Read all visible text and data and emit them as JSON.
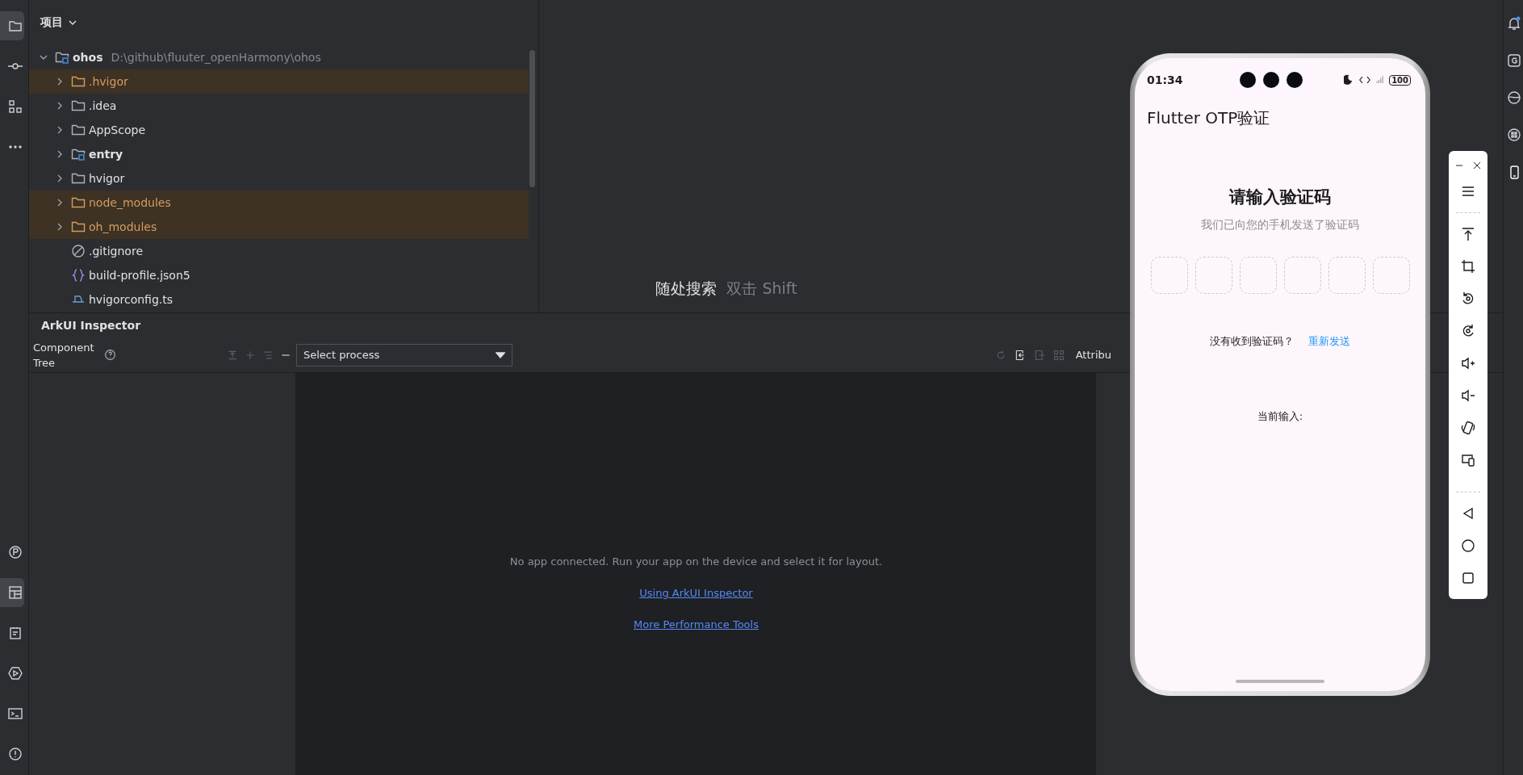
{
  "left_toolbar": {
    "top": [
      {
        "kind": "folder",
        "selected": true
      },
      {
        "kind": "commit",
        "selected": false
      },
      {
        "kind": "structure",
        "selected": false
      },
      {
        "kind": "more",
        "selected": false
      }
    ],
    "bottom": [
      {
        "kind": "plugin",
        "selected": false
      },
      {
        "kind": "layout",
        "selected": true
      },
      {
        "kind": "notes",
        "selected": false
      },
      {
        "kind": "run",
        "selected": false
      },
      {
        "kind": "terminal",
        "selected": false
      },
      {
        "kind": "problems",
        "selected": false
      }
    ]
  },
  "project": {
    "title": "项目",
    "root": {
      "name": "ohos",
      "path": "D:\\github\\fluuter_openHarmony\\ohos",
      "kind": "module",
      "expanded": true,
      "excluded": false,
      "children": [
        {
          "name": ".hvigor",
          "kind": "folder",
          "expanded": false,
          "excluded": true
        },
        {
          "name": ".idea",
          "kind": "folder",
          "expanded": false,
          "excluded": false
        },
        {
          "name": "AppScope",
          "kind": "folder",
          "expanded": false,
          "excluded": false
        },
        {
          "name": "entry",
          "kind": "module",
          "expanded": false,
          "excluded": false
        },
        {
          "name": "hvigor",
          "kind": "folder",
          "expanded": false,
          "excluded": false
        },
        {
          "name": "node_modules",
          "kind": "folder",
          "expanded": false,
          "excluded": true
        },
        {
          "name": "oh_modules",
          "kind": "folder",
          "expanded": false,
          "excluded": true
        },
        {
          "name": ".gitignore",
          "kind": "ignore",
          "excluded": false
        },
        {
          "name": "build-profile.json5",
          "kind": "json",
          "excluded": false
        },
        {
          "name": "hvigorconfig.ts",
          "kind": "config",
          "excluded": false
        }
      ]
    }
  },
  "editor": {
    "hint": "随处搜索",
    "shortcut": "双击 Shift"
  },
  "inspector": {
    "title": "ArkUI Inspector",
    "tree_label": "Component Tree",
    "process_select": {
      "value": "Select process"
    },
    "attributes_label": "Attribu",
    "message": "No app connected. Run your app on the device and select it for layout.",
    "links": [
      "Using ArkUI Inspector",
      "More Performance Tools"
    ]
  },
  "device": {
    "status_bar": {
      "time": "01:34",
      "battery": "100"
    },
    "app_title": "Flutter OTP验证",
    "heading": "请输入验证码",
    "subtitle": "我们已向您的手机发送了验证码",
    "otp_boxes": [
      {
        "filled": false
      },
      {
        "filled": false
      },
      {
        "filled": false
      },
      {
        "filled": false
      },
      {
        "filled": false
      },
      {
        "filled": false
      }
    ],
    "resend_prompt": "没有收到验证码？",
    "resend_link": "重新发送",
    "current_input_label": "当前输入:"
  }
}
